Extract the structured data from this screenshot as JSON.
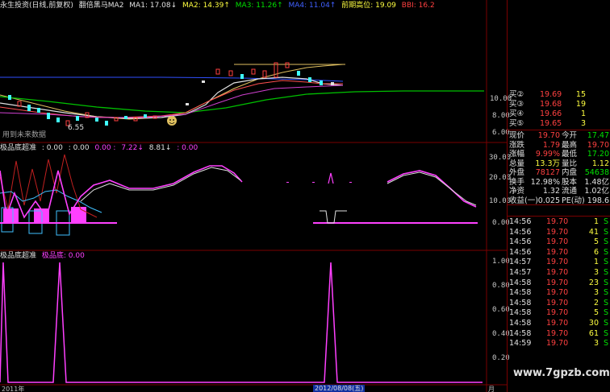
{
  "top_bar": {
    "title": "永生投资(日线,前复权)",
    "indicator_name": "翻倍黑马MA2",
    "ma1": "MA1: 17.08↓",
    "ma2": "MA2: 14.39↑",
    "ma3": "MA3: 11.26↑",
    "ma4": "MA4: 11.04↑",
    "high_label": "前期高位: 19.09",
    "bbi": "BBI: 16.2"
  },
  "price_axis": [
    "10.00",
    "8.00",
    "6.00"
  ],
  "price_annotation": "6.55",
  "future_label": "用到未来数据",
  "panel2": {
    "name": "极品底超准",
    "v1": ": 0.00",
    "v2": ": 0.00",
    "v3": "0.00 :",
    "v4": "7.22↓",
    "v5": "8.81↓",
    "v6": ": 0.00",
    "axis": [
      "30.00",
      "20.00",
      "10.00",
      "0.00"
    ]
  },
  "panel3": {
    "name": "极品底超准",
    "value": "极品底: 0.00",
    "axis": [
      "1.00",
      "0.80",
      "0.60",
      "0.40",
      "0.20"
    ]
  },
  "bottom_axis": {
    "left": "2011年",
    "date_box": "2012/08/08(五)",
    "right": "月"
  },
  "watermark": "www.7gpzb.com",
  "colors": {
    "up": "#ff4040",
    "down": "#40ffff",
    "magenta": "#ff40ff",
    "green_line": "#00c000",
    "white_line": "#e0e0e0"
  },
  "order_book": [
    {
      "label": "买②",
      "price": "19.69",
      "vol": "15"
    },
    {
      "label": "买③",
      "price": "19.68",
      "vol": "19"
    },
    {
      "label": "买④",
      "price": "19.66",
      "vol": "1"
    },
    {
      "label": "买⑤",
      "price": "19.65",
      "vol": "3"
    }
  ],
  "quote": [
    {
      "l1": "现价",
      "v1": "19.70",
      "l2": "今开",
      "v2": "17.47"
    },
    {
      "l1": "涨跌",
      "v1": "1.79",
      "l2": "最高",
      "v2": "19.70"
    },
    {
      "l1": "涨幅",
      "v1": "9.99%",
      "l2": "最低",
      "v2": "17.20"
    },
    {
      "l1": "总量",
      "v1": "13.3万",
      "l2": "量比",
      "v2": "1.12"
    },
    {
      "l1": "外盘",
      "v1": "78127",
      "l2": "内盘",
      "v2": "54638"
    },
    {
      "l1": "换手",
      "v1": "12.98%",
      "l2": "股本",
      "v2": "1.48亿"
    },
    {
      "l1": "净资",
      "v1": "1.32",
      "l2": "流通",
      "v2": "1.02亿"
    },
    {
      "l1": "收益(一)",
      "v1": "0.025",
      "l2": "PE(动)",
      "v2": "198.6"
    }
  ],
  "trades": [
    {
      "time": "14:56",
      "price": "19.70",
      "vol": "1",
      "side": "S"
    },
    {
      "time": "14:56",
      "price": "19.70",
      "vol": "41",
      "side": "S"
    },
    {
      "time": "14:56",
      "price": "19.70",
      "vol": "5",
      "side": "S"
    },
    {
      "time": "14:56",
      "price": "19.70",
      "vol": "6",
      "side": "S"
    },
    {
      "time": "14:57",
      "price": "19.70",
      "vol": "1",
      "side": "S"
    },
    {
      "time": "14:57",
      "price": "19.70",
      "vol": "3",
      "side": "S"
    },
    {
      "time": "14:58",
      "price": "19.70",
      "vol": "23",
      "side": "S"
    },
    {
      "time": "14:58",
      "price": "19.70",
      "vol": "3",
      "side": "S"
    },
    {
      "time": "14:58",
      "price": "19.70",
      "vol": "2",
      "side": "S"
    },
    {
      "time": "14:58",
      "price": "19.70",
      "vol": "5",
      "side": "S"
    },
    {
      "time": "14:58",
      "price": "19.70",
      "vol": "30",
      "side": "S"
    },
    {
      "time": "14:58",
      "price": "19.70",
      "vol": "61",
      "side": "S"
    },
    {
      "time": "14:59",
      "price": "19.70",
      "vol": "3",
      "side": "S"
    }
  ]
}
